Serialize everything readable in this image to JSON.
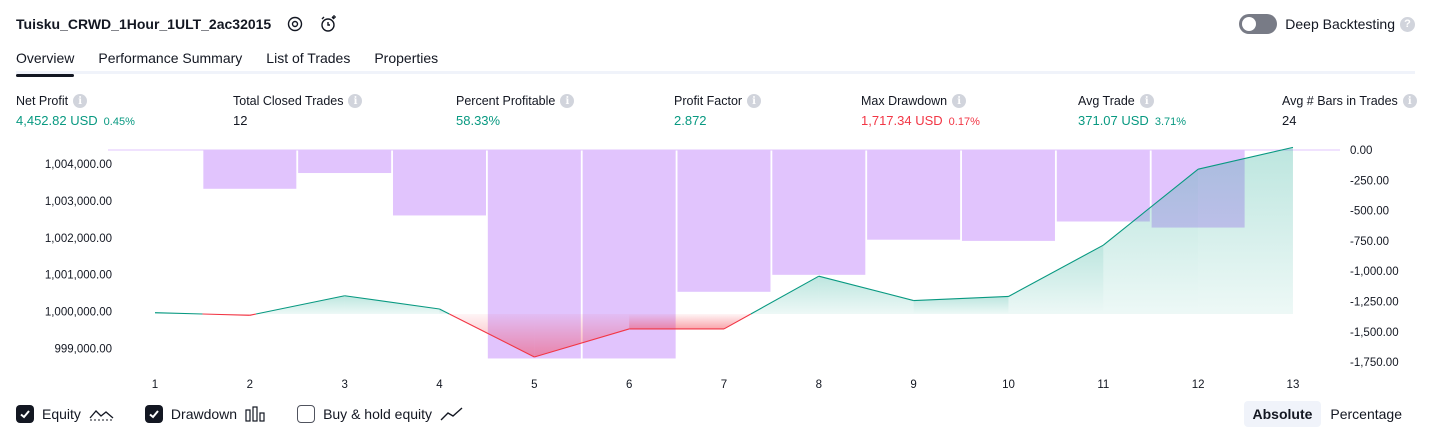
{
  "header": {
    "strategy_name": "Tuisku_CRWD_1Hour_1ULT_2ac32015",
    "deep_backtesting_label": "Deep Backtesting"
  },
  "tabs": [
    {
      "label": "Overview",
      "active": true
    },
    {
      "label": "Performance Summary",
      "active": false
    },
    {
      "label": "List of Trades",
      "active": false
    },
    {
      "label": "Properties",
      "active": false
    }
  ],
  "stats": {
    "net_profit": {
      "label": "Net Profit",
      "value": "4,452.82 USD",
      "pct": "0.45%"
    },
    "total_closed_trades": {
      "label": "Total Closed Trades",
      "value": "12"
    },
    "percent_profitable": {
      "label": "Percent Profitable",
      "value": "58.33%"
    },
    "profit_factor": {
      "label": "Profit Factor",
      "value": "2.872"
    },
    "max_drawdown": {
      "label": "Max Drawdown",
      "value": "1,717.34 USD",
      "pct": "0.17%"
    },
    "avg_trade": {
      "label": "Avg Trade",
      "value": "371.07 USD",
      "pct": "3.71%"
    },
    "avg_bars": {
      "label": "Avg # Bars in Trades",
      "value": "24"
    }
  },
  "colors": {
    "profit": "#089981",
    "loss": "#f23645",
    "drawdown_bar": "#e1c4fd",
    "equity_fill": "#cdeee6"
  },
  "chart_data": {
    "type": "line",
    "x": [
      1,
      2,
      3,
      4,
      5,
      6,
      7,
      8,
      9,
      10,
      11,
      12,
      13
    ],
    "left_axis_ticks": [
      "1,004,000.00",
      "1,003,000.00",
      "1,002,000.00",
      "1,001,000.00",
      "1,000,000.00",
      "999,000.00"
    ],
    "right_axis_ticks": [
      "0.00",
      "-250.00",
      "-500.00",
      "-750.00",
      "-1,000.00",
      "-1,250.00",
      "-1,500.00",
      "-1,750.00"
    ],
    "ylim_left": [
      998580,
      1004450
    ],
    "ylim_right": [
      -1800,
      0
    ],
    "series": [
      {
        "name": "Equity",
        "axis": "left",
        "values": [
          999970,
          999900,
          1000430,
          1000070,
          998770,
          999530,
          999530,
          1000960,
          1000300,
          1000410,
          1001800,
          1003860,
          1004450
        ]
      },
      {
        "name": "Drawdown",
        "axis": "right",
        "type": "bar",
        "values": [
          null,
          -320,
          -190,
          -540,
          -1720,
          -1720,
          -1170,
          -1030,
          -740,
          -750,
          -590,
          -640,
          null
        ]
      }
    ]
  },
  "legend": [
    {
      "label": "Equity",
      "checked": true,
      "icon": "equity-line-icon"
    },
    {
      "label": "Drawdown",
      "checked": true,
      "icon": "drawdown-bars-icon"
    },
    {
      "label": "Buy & hold equity",
      "checked": false,
      "icon": "buy-hold-line-icon"
    }
  ],
  "scale_toggle": {
    "absolute_label": "Absolute",
    "percentage_label": "Percentage",
    "selected": "Absolute"
  }
}
